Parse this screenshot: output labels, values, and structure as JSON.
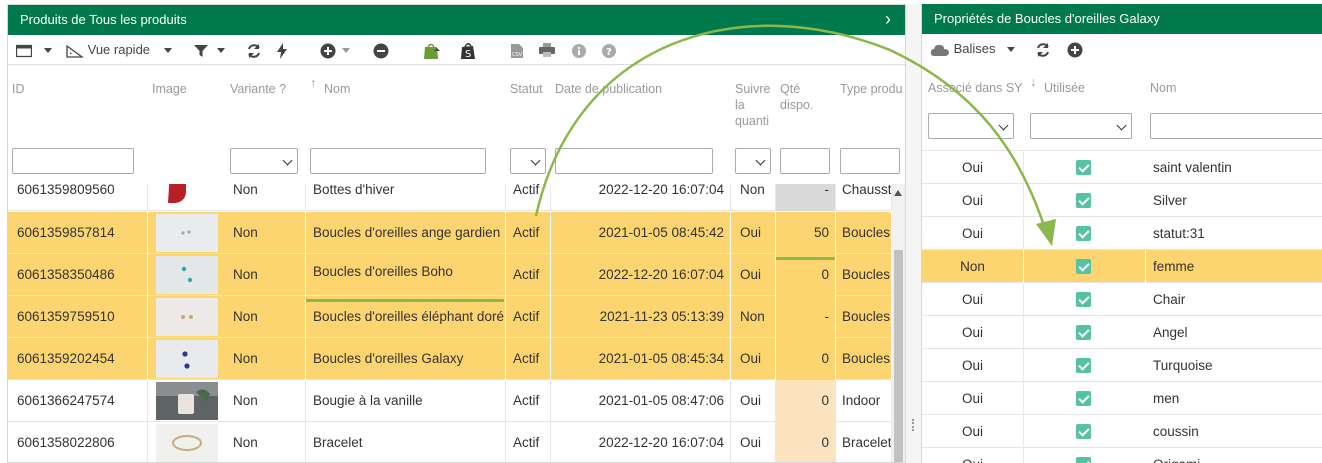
{
  "left": {
    "title": "Produits de Tous les produits",
    "toolbar": {
      "quick_view": "Vue rapide"
    },
    "headers": {
      "id": "ID",
      "image": "Image",
      "variant": "Variante ?",
      "name": "Nom",
      "status": "Statut",
      "pub_date": "Date de publication",
      "track": [
        "Suivre",
        "la",
        "quanti"
      ],
      "qty": [
        "Qté",
        "dispo."
      ],
      "type": "Type produ"
    },
    "rows": [
      {
        "id": "6061359809560",
        "variant": "Non",
        "name": "Bottes d'hiver",
        "status": "Actif",
        "date": "2022-12-20 16:07:04",
        "track": "Non",
        "qty": "-",
        "type": "Chausst"
      },
      {
        "id": "6061359857814",
        "variant": "Non",
        "name": "Boucles d'oreilles ange gardien",
        "status": "Actif",
        "date": "2021-01-05 08:45:42",
        "track": "Oui",
        "qty": "50",
        "type": "Boucles"
      },
      {
        "id": "6061358350486",
        "variant": "Non",
        "name": "Boucles d'oreilles Boho",
        "status": "Actif",
        "date": "2022-12-20 16:07:04",
        "track": "Oui",
        "qty": "0",
        "type": "Boucles"
      },
      {
        "id": "6061359759510",
        "variant": "Non",
        "name": "Boucles d'oreilles éléphant doré",
        "status": "Actif",
        "date": "2021-11-23 05:13:39",
        "track": "Non",
        "qty": "-",
        "type": "Boucles"
      },
      {
        "id": "6061359202454",
        "variant": "Non",
        "name": "Boucles d'oreilles Galaxy",
        "status": "Actif",
        "date": "2021-01-05 08:45:34",
        "track": "Oui",
        "qty": "0",
        "type": "Boucles"
      },
      {
        "id": "6061366247574",
        "variant": "Non",
        "name": "Bougie à la vanille",
        "status": "Actif",
        "date": "2021-01-05 08:47:06",
        "track": "Oui",
        "qty": "0",
        "type": "Indoor"
      },
      {
        "id": "6061358022806",
        "variant": "Non",
        "name": "Bracelet",
        "status": "Actif",
        "date": "2022-12-20 16:07:04",
        "track": "Oui",
        "qty": "0",
        "type": "Bracelet"
      }
    ]
  },
  "right": {
    "title": "Propriétés de Boucles d'oreilles Galaxy",
    "toolbar": {
      "tags": "Balises"
    },
    "headers": {
      "associated": "Associé dans SY",
      "used": "Utilisée",
      "name": "Nom"
    },
    "rows": [
      {
        "assoc": "Oui",
        "name": "saint valentin"
      },
      {
        "assoc": "Oui",
        "name": "Silver"
      },
      {
        "assoc": "Oui",
        "name": "statut:31"
      },
      {
        "assoc": "Non",
        "name": "femme"
      },
      {
        "assoc": "Oui",
        "name": "Chair"
      },
      {
        "assoc": "Oui",
        "name": "Angel"
      },
      {
        "assoc": "Oui",
        "name": "Turquoise"
      },
      {
        "assoc": "Oui",
        "name": "men"
      },
      {
        "assoc": "Oui",
        "name": "coussin"
      },
      {
        "assoc": "Oui",
        "name": "Origami"
      }
    ]
  },
  "colors": {
    "header_green": "#007a4d",
    "selection": "#fdd570",
    "check": "#55c2a4",
    "annotation": "#8ab84a"
  }
}
